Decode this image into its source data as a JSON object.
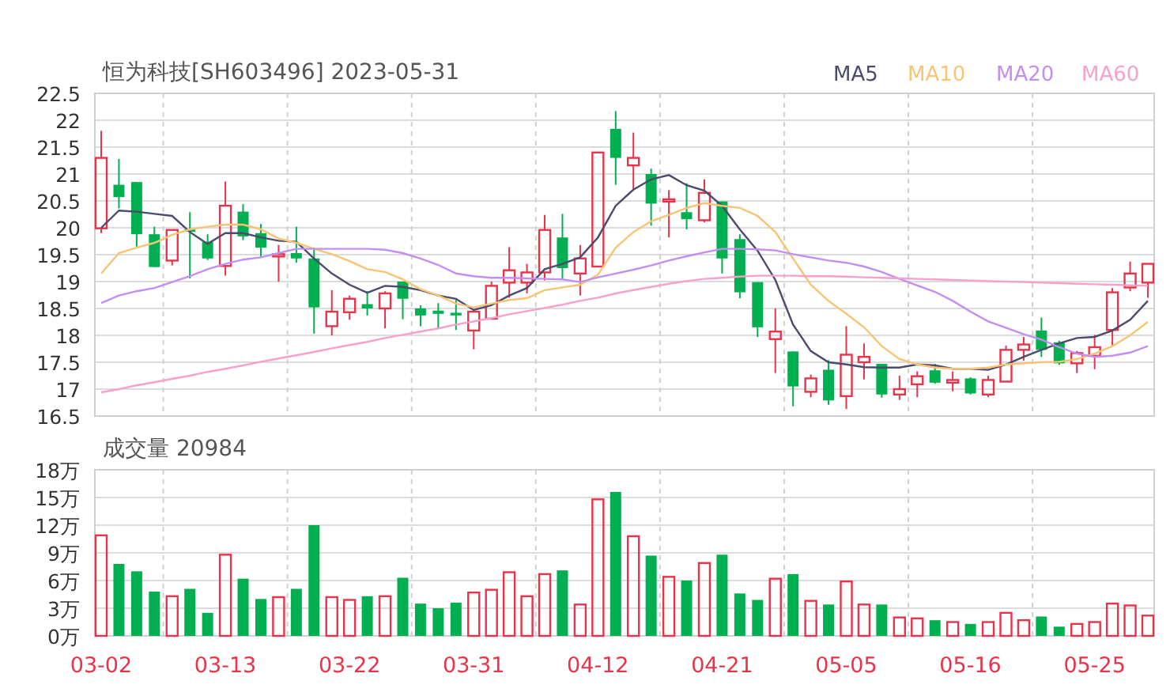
{
  "price_chart": {
    "moving_averages": {
      "chart_data": {
        "type": "line",
        "title": "恒为科技[SH603496] 2023-05-31",
        "ylim": [
          16.5,
          22.5
        ],
        "categories": [
          null,
          null,
          null,
          null,
          null,
          null,
          null,
          null,
          null,
          null,
          null,
          null,
          null,
          null,
          null,
          null,
          null,
          null,
          null,
          null,
          null,
          null,
          null,
          null,
          null,
          null,
          null,
          null,
          null,
          null,
          null,
          null,
          null,
          null,
          null,
          null,
          null,
          null,
          null,
          null,
          null,
          null,
          null,
          null,
          null,
          null,
          null,
          null,
          null,
          null,
          null,
          null,
          null,
          null,
          null,
          null,
          null,
          null,
          null,
          null
        ],
        "series": [
          {
            "name": "MA5",
            "color": "#4b4b6e",
            "values": [
              20.0,
              20.32,
              20.3,
              20.26,
              20.22,
              19.92,
              19.7,
              19.9,
              19.9,
              19.82,
              19.76,
              19.74,
              19.43,
              19.15,
              18.94,
              18.79,
              18.92,
              18.9,
              18.84,
              18.74,
              18.68,
              18.47,
              18.56,
              18.74,
              18.88,
              19.23,
              19.33,
              19.45,
              19.82,
              20.41,
              20.71,
              20.9,
              20.98,
              20.79,
              20.69,
              20.41,
              19.97,
              19.57,
              19.03,
              18.2,
              17.71,
              17.5,
              17.46,
              17.41,
              17.4,
              17.4,
              17.46,
              17.44,
              17.38,
              17.38,
              17.36,
              17.46,
              17.6,
              17.73,
              17.85,
              17.95,
              17.97,
              18.09,
              18.29,
              18.64
            ]
          },
          {
            "name": "MA10",
            "color": "#f8c473",
            "values": [
              19.15,
              19.53,
              19.63,
              19.72,
              19.87,
              19.97,
              20.02,
              20.06,
              20.06,
              19.97,
              19.8,
              19.72,
              19.61,
              19.51,
              19.38,
              19.23,
              19.18,
              19.04,
              18.86,
              18.74,
              18.59,
              18.52,
              18.59,
              18.66,
              18.69,
              18.84,
              18.89,
              18.94,
              19.13,
              19.63,
              19.92,
              20.12,
              20.24,
              20.37,
              20.46,
              20.41,
              20.37,
              20.22,
              19.92,
              19.43,
              18.94,
              18.64,
              18.4,
              18.15,
              17.8,
              17.56,
              17.46,
              17.4,
              17.38,
              17.38,
              17.4,
              17.46,
              17.48,
              17.5,
              17.51,
              17.56,
              17.66,
              17.8,
              18.0,
              18.25
            ]
          },
          {
            "name": "MA20",
            "color": "#c48ef0",
            "values": [
              18.6,
              18.74,
              18.82,
              18.88,
              18.99,
              19.1,
              19.23,
              19.33,
              19.41,
              19.45,
              19.53,
              19.61,
              19.61,
              19.61,
              19.61,
              19.61,
              19.59,
              19.53,
              19.43,
              19.31,
              19.15,
              19.1,
              19.07,
              19.07,
              19.06,
              19.05,
              19.04,
              18.99,
              19.08,
              19.15,
              19.22,
              19.3,
              19.39,
              19.47,
              19.54,
              19.61,
              19.61,
              19.6,
              19.58,
              19.51,
              19.45,
              19.39,
              19.35,
              19.28,
              19.18,
              19.05,
              18.93,
              18.81,
              18.64,
              18.44,
              18.26,
              18.14,
              18.02,
              17.92,
              17.78,
              17.66,
              17.6,
              17.62,
              17.68,
              17.8
            ]
          },
          {
            "name": "MA60",
            "color": "#f7a0cc",
            "values": [
              16.94,
              17.0,
              17.07,
              17.13,
              17.19,
              17.25,
              17.32,
              17.38,
              17.44,
              17.51,
              17.57,
              17.63,
              17.69,
              17.76,
              17.82,
              17.88,
              17.95,
              18.01,
              18.07,
              18.13,
              18.2,
              18.26,
              18.32,
              18.39,
              18.45,
              18.51,
              18.57,
              18.64,
              18.7,
              18.78,
              18.84,
              18.9,
              18.96,
              19.01,
              19.05,
              19.07,
              19.09,
              19.11,
              19.11,
              19.11,
              19.1,
              19.1,
              19.09,
              19.08,
              19.07,
              19.06,
              19.05,
              19.04,
              19.03,
              19.02,
              19.01,
              19.0,
              18.99,
              18.98,
              18.97,
              18.96,
              18.95,
              18.94,
              18.93,
              18.92
            ]
          }
        ]
      }
    },
    "candles": {
      "chart_data": {
        "type": "candlestick",
        "grid": true,
        "ylim": [
          16.5,
          22.5
        ],
        "yticks": [
          16.5,
          17,
          17.5,
          18,
          18.5,
          19,
          19.5,
          20,
          20.5,
          21,
          21.5,
          22,
          22.5
        ],
        "categories": [
          null,
          null,
          null,
          null,
          null,
          null,
          null,
          null,
          null,
          null,
          null,
          null,
          null,
          null,
          null,
          null,
          null,
          null,
          null,
          null,
          null,
          null,
          null,
          null,
          null,
          null,
          null,
          null,
          null,
          null,
          null,
          null,
          null,
          null,
          null,
          null,
          null,
          null,
          null,
          null,
          null,
          null,
          null,
          null,
          null,
          null,
          null,
          null,
          null,
          null,
          null,
          null,
          null,
          null,
          null,
          null,
          null,
          null,
          null,
          null
        ],
        "ohlc": [
          [
            19.99,
            21.8,
            19.9,
            21.3
          ],
          [
            20.8,
            21.28,
            20.36,
            20.57
          ],
          [
            20.85,
            20.85,
            19.65,
            19.88
          ],
          [
            19.88,
            20.02,
            19.27,
            19.27
          ],
          [
            19.39,
            19.96,
            19.3,
            19.96
          ],
          [
            19.97,
            20.29,
            19.06,
            19.93
          ],
          [
            19.74,
            19.88,
            19.4,
            19.43
          ],
          [
            19.29,
            20.86,
            19.11,
            20.41
          ],
          [
            20.3,
            20.44,
            19.77,
            19.84
          ],
          [
            19.9,
            20.07,
            19.46,
            19.63
          ],
          [
            19.48,
            19.68,
            19.0,
            19.51
          ],
          [
            19.53,
            20.02,
            19.35,
            19.43
          ],
          [
            19.43,
            19.63,
            18.03,
            18.52
          ],
          [
            18.17,
            18.84,
            18.0,
            18.44
          ],
          [
            18.43,
            18.74,
            18.29,
            18.68
          ],
          [
            18.58,
            18.82,
            18.37,
            18.5
          ],
          [
            18.5,
            18.82,
            18.13,
            18.78
          ],
          [
            19.0,
            19.0,
            18.3,
            18.68
          ],
          [
            18.5,
            18.56,
            18.17,
            18.37
          ],
          [
            18.46,
            18.6,
            18.13,
            18.4
          ],
          [
            18.42,
            18.66,
            18.1,
            18.37
          ],
          [
            18.09,
            18.44,
            17.74,
            18.44
          ],
          [
            18.31,
            19.0,
            18.31,
            18.92
          ],
          [
            18.98,
            19.64,
            18.7,
            19.21
          ],
          [
            18.98,
            19.33,
            18.78,
            19.17
          ],
          [
            19.17,
            20.24,
            19.02,
            19.96
          ],
          [
            19.82,
            20.26,
            19.06,
            19.25
          ],
          [
            19.15,
            19.68,
            18.74,
            19.43
          ],
          [
            19.28,
            21.4,
            19.28,
            21.4
          ],
          [
            21.84,
            22.17,
            20.8,
            21.3
          ],
          [
            21.16,
            21.77,
            20.7,
            21.3
          ],
          [
            21.0,
            21.1,
            20.04,
            20.45
          ],
          [
            20.5,
            20.7,
            19.82,
            20.53
          ],
          [
            20.29,
            20.83,
            19.97,
            20.16
          ],
          [
            20.14,
            20.9,
            20.1,
            20.65
          ],
          [
            20.49,
            20.49,
            19.15,
            19.43
          ],
          [
            19.79,
            19.88,
            18.69,
            18.8
          ],
          [
            18.99,
            18.99,
            17.97,
            18.15
          ],
          [
            17.93,
            18.5,
            17.3,
            18.07
          ],
          [
            17.7,
            17.7,
            16.68,
            17.05
          ],
          [
            16.95,
            17.27,
            16.85,
            17.2
          ],
          [
            17.36,
            17.54,
            16.71,
            16.79
          ],
          [
            16.87,
            18.17,
            16.63,
            17.64
          ],
          [
            17.5,
            17.85,
            17.18,
            17.6
          ],
          [
            17.47,
            17.47,
            16.84,
            16.9
          ],
          [
            16.9,
            17.25,
            16.8,
            17.0
          ],
          [
            17.09,
            17.33,
            16.85,
            17.24
          ],
          [
            17.35,
            17.47,
            17.1,
            17.12
          ],
          [
            17.12,
            17.33,
            16.96,
            17.17
          ],
          [
            17.2,
            17.22,
            16.9,
            16.92
          ],
          [
            16.9,
            17.25,
            16.85,
            17.17
          ],
          [
            17.14,
            17.81,
            17.14,
            17.73
          ],
          [
            17.73,
            17.97,
            17.53,
            17.83
          ],
          [
            18.09,
            18.33,
            17.6,
            17.73
          ],
          [
            17.87,
            17.9,
            17.45,
            17.48
          ],
          [
            17.48,
            17.71,
            17.3,
            17.67
          ],
          [
            17.62,
            18.01,
            17.37,
            17.78
          ],
          [
            18.1,
            18.88,
            17.8,
            18.8
          ],
          [
            18.89,
            19.37,
            18.82,
            19.15
          ],
          [
            18.98,
            19.33,
            18.7,
            19.33
          ]
        ]
      }
    }
  },
  "volume_chart": {
    "chart_data": {
      "type": "bar",
      "title": "成交量 20984",
      "grid": true,
      "ylim": [
        0,
        18
      ],
      "yticks": [
        {
          "value": 0,
          "label": "0万"
        },
        {
          "value": 3,
          "label": "3万"
        },
        {
          "value": 6,
          "label": "6万"
        },
        {
          "value": 9,
          "label": "9万"
        },
        {
          "value": 12,
          "label": "12万"
        },
        {
          "value": 15,
          "label": "15万"
        },
        {
          "value": 18,
          "label": "18万"
        }
      ],
      "categories": [
        "03-02",
        null,
        null,
        null,
        null,
        null,
        null,
        "03-13",
        null,
        null,
        null,
        null,
        null,
        null,
        "03-22",
        null,
        null,
        null,
        null,
        null,
        null,
        "03-31",
        null,
        null,
        null,
        null,
        null,
        null,
        "04-12",
        null,
        null,
        null,
        null,
        null,
        null,
        "04-21",
        null,
        null,
        null,
        null,
        null,
        null,
        "05-05",
        null,
        null,
        null,
        null,
        null,
        null,
        "05-16",
        null,
        null,
        null,
        null,
        null,
        null,
        "05-25",
        null,
        null,
        null
      ],
      "values": [
        10.9,
        7.8,
        7.0,
        4.8,
        4.3,
        5.1,
        2.5,
        8.8,
        6.2,
        4.0,
        4.2,
        5.1,
        12.0,
        4.2,
        3.9,
        4.3,
        4.3,
        6.3,
        3.5,
        3.0,
        3.6,
        4.7,
        5.0,
        6.9,
        4.3,
        6.7,
        7.1,
        3.4,
        14.8,
        15.6,
        10.8,
        8.7,
        6.4,
        6.0,
        7.9,
        8.8,
        4.6,
        3.9,
        6.2,
        6.7,
        3.8,
        3.4,
        5.9,
        3.4,
        3.4,
        2.0,
        1.9,
        1.7,
        1.5,
        1.3,
        1.5,
        2.5,
        1.7,
        2.1,
        1.0,
        1.3,
        1.5,
        3.5,
        3.3,
        2.2
      ]
    }
  }
}
